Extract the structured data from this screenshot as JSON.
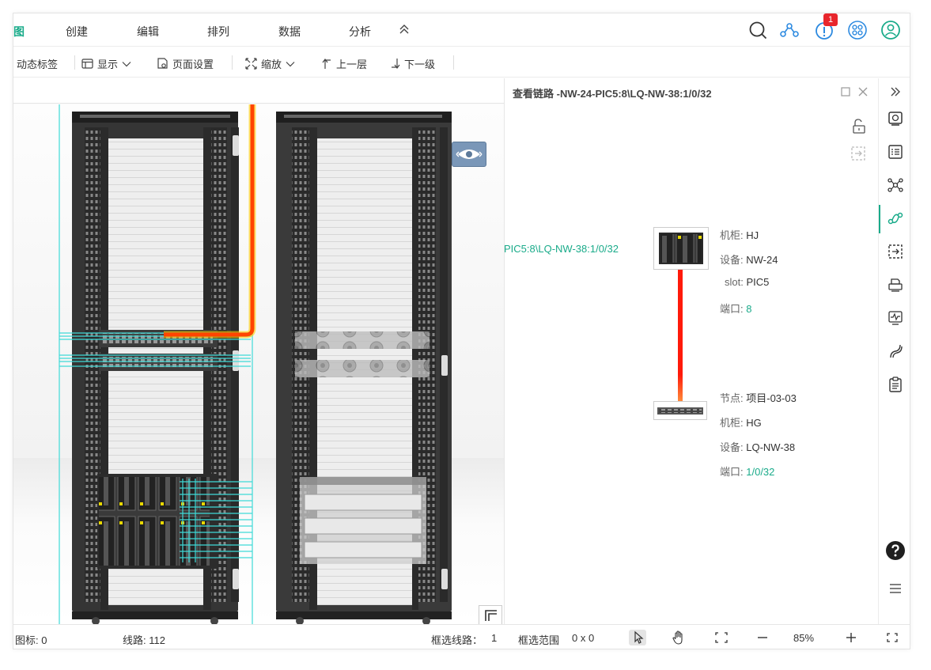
{
  "menubar": {
    "tabs": [
      {
        "label": "图",
        "active": true
      },
      {
        "label": "创建"
      },
      {
        "label": "编辑"
      },
      {
        "label": "排列"
      },
      {
        "label": "数据"
      },
      {
        "label": "分析"
      }
    ],
    "notification_count": "1",
    "accent_color": "#1aab8a"
  },
  "toolbar": {
    "dynamic_label": "动态标签",
    "display": "显示",
    "page_settings": "页面设置",
    "zoom": "缩放",
    "level_up": "上一层",
    "level_down": "下一级"
  },
  "canvas": {
    "link_label": "PIC5:8\\LQ-NW-38:1/0/32",
    "highlight_color": "#ff4400",
    "cable_color": "#3fdad8"
  },
  "panel": {
    "title": "查看链路 -NW-24-PIC5:8\\LQ-NW-38:1/0/32",
    "source": {
      "cabinet_key": "机柜:",
      "cabinet": "HJ",
      "device_key": "设备:",
      "device": "NW-24",
      "slot_key": "slot:",
      "slot": "PIC5",
      "port_key": "端口:",
      "port": "8"
    },
    "target": {
      "node_key": "节点:",
      "node": "项目-03-03",
      "cabinet_key": "机柜:",
      "cabinet": "HG",
      "device_key": "设备:",
      "device": "LQ-NW-38",
      "port_key": "端口:",
      "port": "1/0/32"
    },
    "link_color": "#ff1a0a"
  },
  "statusbar": {
    "icons_label": "图标: 0",
    "lines_label": "线路: 112",
    "selected_lines_label": "框选线路：",
    "selected_lines_value": "1",
    "selected_range_label": "框选范围",
    "selected_range_value": "0 x 0",
    "zoom_value": "85%"
  }
}
